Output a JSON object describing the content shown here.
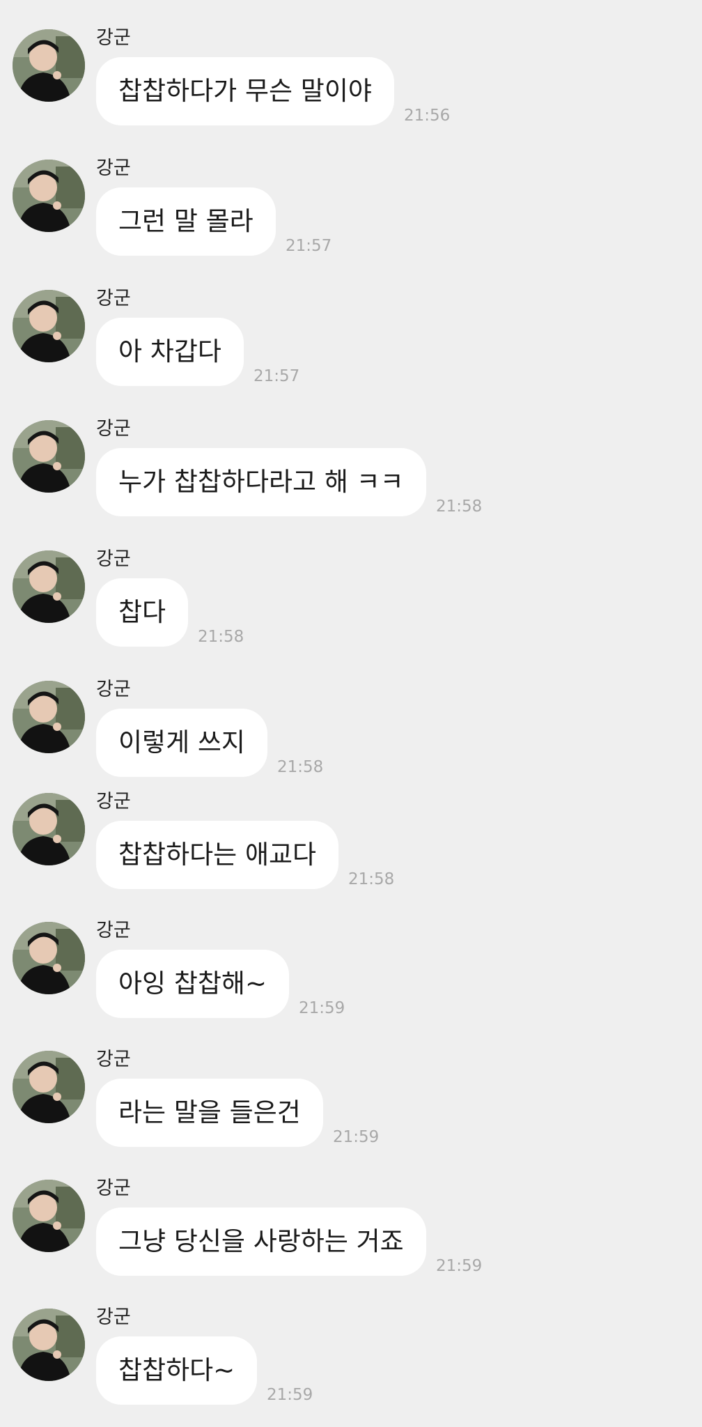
{
  "conversation": {
    "messages": [
      {
        "sender": "강군",
        "text": "찹찹하다가 무슨 말이야",
        "time": "21:56"
      },
      {
        "sender": "강군",
        "text": "그런 말 몰라",
        "time": "21:57"
      },
      {
        "sender": "강군",
        "text": "아 차갑다",
        "time": "21:57"
      },
      {
        "sender": "강군",
        "text": "누가 찹찹하다라고 해 ㅋㅋ",
        "time": "21:58"
      },
      {
        "sender": "강군",
        "text": "찹다",
        "time": "21:58"
      },
      {
        "sender": "강군",
        "text": "이렇게 쓰지",
        "time": "21:58"
      },
      {
        "sender": "강군",
        "text": "찹찹하다는 애교다",
        "time": "21:58"
      },
      {
        "sender": "강군",
        "text": "아잉 찹찹해~",
        "time": "21:59"
      },
      {
        "sender": "강군",
        "text": "라는 말을 들은건",
        "time": "21:59"
      },
      {
        "sender": "강군",
        "text": "그냥 당신을 사랑하는 거죠",
        "time": "21:59"
      },
      {
        "sender": "강군",
        "text": "찹찹하다~",
        "time": "21:59"
      }
    ]
  },
  "theme": {
    "background": "#efefef",
    "bubble": "#ffffff",
    "time_text": "#a8a8a8"
  }
}
